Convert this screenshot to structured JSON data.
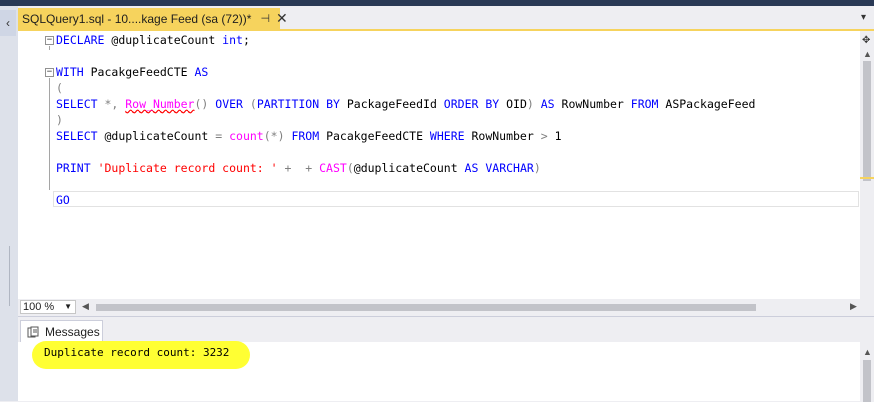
{
  "tab": {
    "title": "SQLQuery1.sql - 10....kage Feed (sa (72))*",
    "pin_icon": "pin-icon",
    "close_icon": "close-icon"
  },
  "editor": {
    "lines": {
      "l1": {
        "kw1": "DECLARE",
        "t1": " @duplicateCount ",
        "kw2": "int",
        "t2": ";"
      },
      "l3": {
        "kw1": "WITH",
        "t1": " PacakgeFeedCTE ",
        "kw2": "AS"
      },
      "l4": {
        "g1": "("
      },
      "l5": {
        "kw1": "SELECT",
        "g1": " *, ",
        "fn1": "Row_Number",
        "g2": "() ",
        "kw2": "OVER",
        "g3": " (",
        "kw3": "PARTITION BY",
        "t1": " PackageFeedId ",
        "kw4": "ORDER BY",
        "t2": " OID",
        "g4": ") ",
        "kw5": "AS",
        "t3": " RowNumber ",
        "kw6": "FROM",
        "t4": " ASPackageFeed"
      },
      "l6": {
        "g1": ")"
      },
      "l7": {
        "kw1": "SELECT",
        "t1": " @duplicateCount ",
        "g1": "= ",
        "fn1": "count",
        "g2": "(*) ",
        "kw2": "FROM",
        "t2": " PacakgeFeedCTE ",
        "kw3": "WHERE",
        "t3": " RowNumber ",
        "g3": ">",
        "t4": " 1"
      },
      "l9": {
        "kw1": "PRINT",
        "t1": " ",
        "s1": "'Duplicate record count: '",
        "g1": " +  + ",
        "fn1": "CAST",
        "g2": "(",
        "t2": "@duplicateCount ",
        "kw2": "AS",
        "t3": " ",
        "kw3": "VARCHAR",
        "g3": ")"
      },
      "l11": {
        "kw1": "GO"
      }
    }
  },
  "zoom": {
    "value": "100 %"
  },
  "results": {
    "tab_label": "Messages",
    "message": "Duplicate record count: 3232"
  },
  "colors": {
    "keyword": "#0000ff",
    "function": "#ff00ff",
    "operator": "#808080",
    "string": "#ff0000",
    "active_tab": "#f6d35d",
    "highlight": "#ffff33"
  }
}
